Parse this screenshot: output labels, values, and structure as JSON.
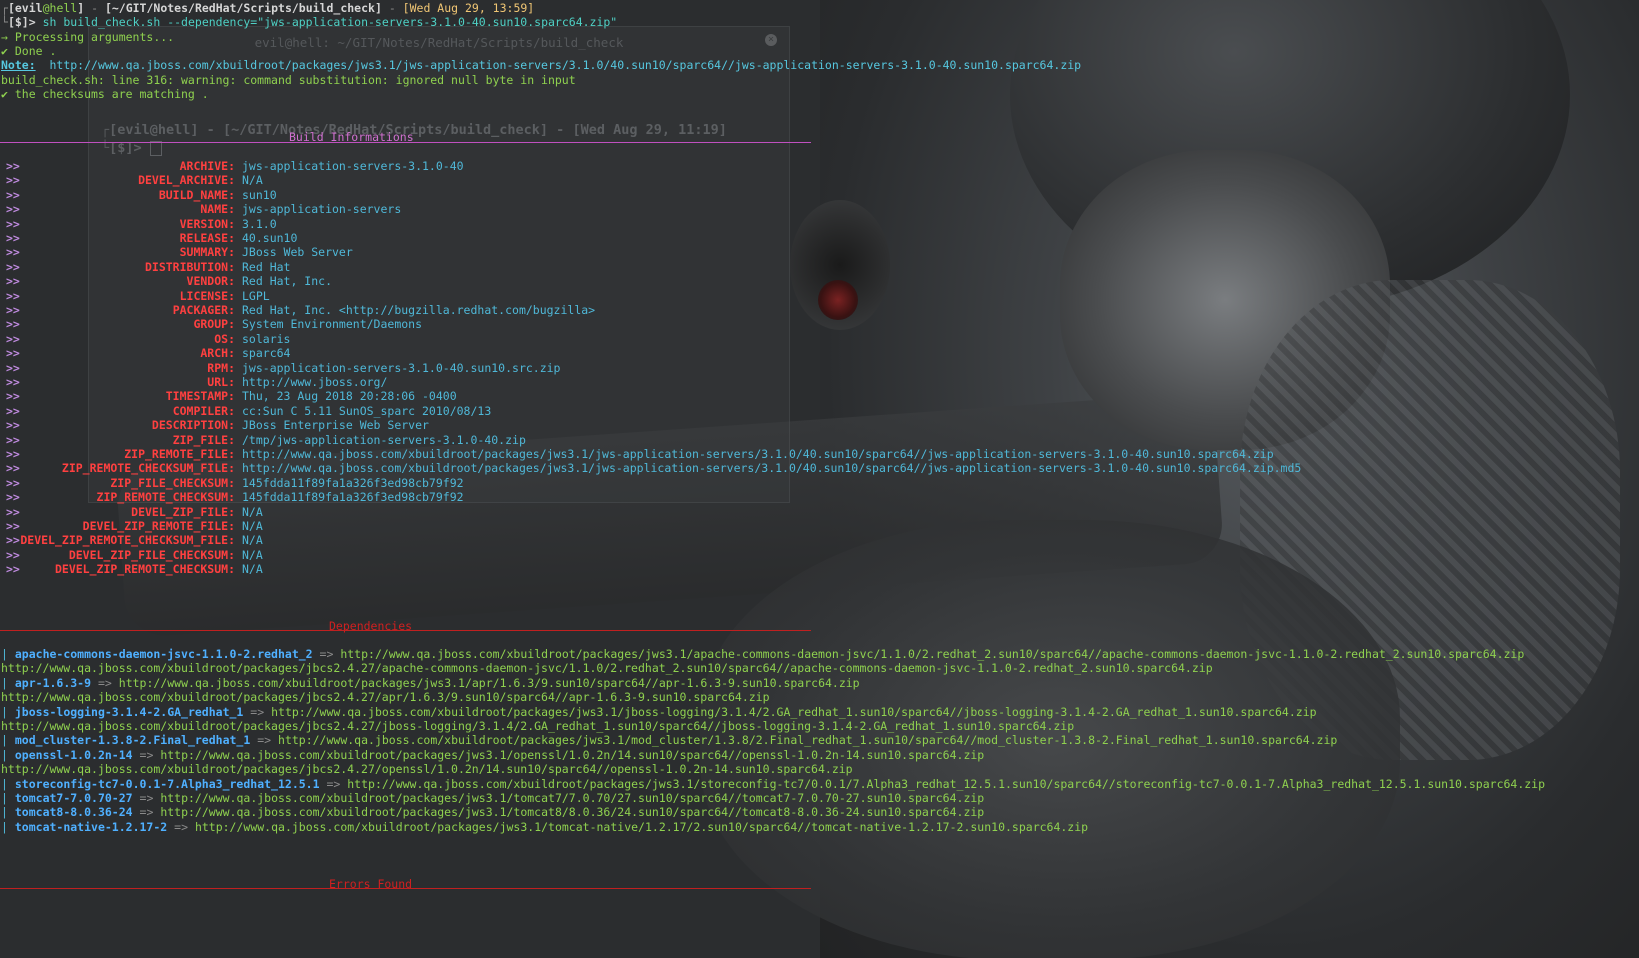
{
  "prompt": {
    "user": "evil",
    "at": "@",
    "host": "hell",
    "path": "[~/GIT/Notes/RedHat/Scripts/build_check]",
    "date": "[Wed Aug 29, 13:59]",
    "ps": "[$]>",
    "command": "sh build_check.sh --dependency=\"jws-application-servers-3.1.0-40.sun10.sparc64.zip\""
  },
  "log": {
    "processing": "→ Processing arguments...",
    "done": "✔ Done .",
    "note_label": "Note:",
    "note_url": "http://www.qa.jboss.com/xbuildroot/packages/jws3.1/jws-application-servers/3.1.0/40.sun10/sparc64//jws-application-servers-3.1.0-40.sun10.sparc64.zip",
    "warning": "build_check.sh: line 316: warning: command substitution: ignored null byte in input",
    "checksums": "✔ the checksums are matching ."
  },
  "ghost_window": {
    "title": "evil@hell: ~/GIT/Notes/RedHat/Scripts/build_check",
    "close": "×",
    "prompt_user": "[evil@hell]",
    "prompt_path": "[~/GIT/Notes/RedHat/Scripts/build_check]",
    "prompt_date": "[Wed Aug 29, 11:19]",
    "prompt_ps": "[$]>"
  },
  "build_info": {
    "title": "Build Informations",
    "arrows": ">>",
    "rows": [
      {
        "key": "ARCHIVE:",
        "value": "jws-application-servers-3.1.0-40"
      },
      {
        "key": "DEVEL_ARCHIVE:",
        "value": "N/A"
      },
      {
        "key": "BUILD_NAME:",
        "value": "sun10"
      },
      {
        "key": "NAME:",
        "value": "jws-application-servers"
      },
      {
        "key": "VERSION:",
        "value": "3.1.0"
      },
      {
        "key": "RELEASE:",
        "value": "40.sun10"
      },
      {
        "key": "SUMMARY:",
        "value": "JBoss Web Server"
      },
      {
        "key": "DISTRIBUTION:",
        "value": "Red Hat"
      },
      {
        "key": "VENDOR:",
        "value": "Red Hat, Inc."
      },
      {
        "key": "LICENSE:",
        "value": "LGPL"
      },
      {
        "key": "PACKAGER:",
        "value": "Red Hat, Inc. <http://bugzilla.redhat.com/bugzilla>"
      },
      {
        "key": "GROUP:",
        "value": "System Environment/Daemons"
      },
      {
        "key": "OS:",
        "value": "solaris"
      },
      {
        "key": "ARCH:",
        "value": "sparc64"
      },
      {
        "key": "RPM:",
        "value": "jws-application-servers-3.1.0-40.sun10.src.zip"
      },
      {
        "key": "URL:",
        "value": "http://www.jboss.org/"
      },
      {
        "key": "TIMESTAMP:",
        "value": "Thu, 23 Aug 2018 20:28:06 -0400"
      },
      {
        "key": "COMPILER:",
        "value": "cc:Sun C 5.11 SunOS_sparc 2010/08/13"
      },
      {
        "key": "DESCRIPTION:",
        "value": "JBoss Enterprise Web Server"
      },
      {
        "key": "ZIP_FILE:",
        "value": "/tmp/jws-application-servers-3.1.0-40.zip"
      },
      {
        "key": "ZIP_REMOTE_FILE:",
        "value": "http://www.qa.jboss.com/xbuildroot/packages/jws3.1/jws-application-servers/3.1.0/40.sun10/sparc64//jws-application-servers-3.1.0-40.sun10.sparc64.zip"
      },
      {
        "key": "ZIP_REMOTE_CHECKSUM_FILE:",
        "value": "http://www.qa.jboss.com/xbuildroot/packages/jws3.1/jws-application-servers/3.1.0/40.sun10/sparc64//jws-application-servers-3.1.0-40.sun10.sparc64.zip.md5"
      },
      {
        "key": "ZIP_FILE_CHECKSUM:",
        "value": "145fdda11f89fa1a326f3ed98cb79f92"
      },
      {
        "key": "ZIP_REMOTE_CHECKSUM:",
        "value": "145fdda11f89fa1a326f3ed98cb79f92"
      },
      {
        "key": "DEVEL_ZIP_FILE:",
        "value": "N/A"
      },
      {
        "key": "DEVEL_ZIP_REMOTE_FILE:",
        "value": "N/A"
      },
      {
        "key": "DEVEL_ZIP_REMOTE_CHECKSUM_FILE:",
        "value": "N/A"
      },
      {
        "key": "DEVEL_ZIP_FILE_CHECKSUM:",
        "value": "N/A"
      },
      {
        "key": "DEVEL_ZIP_REMOTE_CHECKSUM:",
        "value": "N/A"
      }
    ]
  },
  "dependencies": {
    "title": "Dependencies",
    "pipe": "|",
    "arrow": "=>",
    "items": [
      {
        "name": "apache-commons-daemon-jsvc-1.1.0-2.redhat_2",
        "url": "http://www.qa.jboss.com/xbuildroot/packages/jws3.1/apache-commons-daemon-jsvc/1.1.0/2.redhat_2.sun10/sparc64//apache-commons-daemon-jsvc-1.1.0-2.redhat_2.sun10.sparc64.zip",
        "alt": "http://www.qa.jboss.com/xbuildroot/packages/jbcs2.4.27/apache-commons-daemon-jsvc/1.1.0/2.redhat_2.sun10/sparc64//apache-commons-daemon-jsvc-1.1.0-2.redhat_2.sun10.sparc64.zip"
      },
      {
        "name": "apr-1.6.3-9",
        "url": "http://www.qa.jboss.com/xbuildroot/packages/jws3.1/apr/1.6.3/9.sun10/sparc64//apr-1.6.3-9.sun10.sparc64.zip",
        "alt": "http://www.qa.jboss.com/xbuildroot/packages/jbcs2.4.27/apr/1.6.3/9.sun10/sparc64//apr-1.6.3-9.sun10.sparc64.zip"
      },
      {
        "name": "jboss-logging-3.1.4-2.GA_redhat_1",
        "url": "http://www.qa.jboss.com/xbuildroot/packages/jws3.1/jboss-logging/3.1.4/2.GA_redhat_1.sun10/sparc64//jboss-logging-3.1.4-2.GA_redhat_1.sun10.sparc64.zip",
        "alt": "http://www.qa.jboss.com/xbuildroot/packages/jbcs2.4.27/jboss-logging/3.1.4/2.GA_redhat_1.sun10/sparc64//jboss-logging-3.1.4-2.GA_redhat_1.sun10.sparc64.zip"
      },
      {
        "name": "mod_cluster-1.3.8-2.Final_redhat_1",
        "url": "http://www.qa.jboss.com/xbuildroot/packages/jws3.1/mod_cluster/1.3.8/2.Final_redhat_1.sun10/sparc64//mod_cluster-1.3.8-2.Final_redhat_1.sun10.sparc64.zip",
        "alt": ""
      },
      {
        "name": "openssl-1.0.2n-14",
        "url": "http://www.qa.jboss.com/xbuildroot/packages/jws3.1/openssl/1.0.2n/14.sun10/sparc64//openssl-1.0.2n-14.sun10.sparc64.zip",
        "alt": "http://www.qa.jboss.com/xbuildroot/packages/jbcs2.4.27/openssl/1.0.2n/14.sun10/sparc64//openssl-1.0.2n-14.sun10.sparc64.zip"
      },
      {
        "name": "storeconfig-tc7-0.0.1-7.Alpha3_redhat_12.5.1",
        "url": "http://www.qa.jboss.com/xbuildroot/packages/jws3.1/storeconfig-tc7/0.0.1/7.Alpha3_redhat_12.5.1.sun10/sparc64//storeconfig-tc7-0.0.1-7.Alpha3_redhat_12.5.1.sun10.sparc64.zip",
        "alt": ""
      },
      {
        "name": "tomcat7-7.0.70-27",
        "url": "http://www.qa.jboss.com/xbuildroot/packages/jws3.1/tomcat7/7.0.70/27.sun10/sparc64//tomcat7-7.0.70-27.sun10.sparc64.zip",
        "alt": ""
      },
      {
        "name": "tomcat8-8.0.36-24",
        "url": "http://www.qa.jboss.com/xbuildroot/packages/jws3.1/tomcat8/8.0.36/24.sun10/sparc64//tomcat8-8.0.36-24.sun10.sparc64.zip",
        "alt": ""
      },
      {
        "name": "tomcat-native-1.2.17-2",
        "url": "http://www.qa.jboss.com/xbuildroot/packages/jws3.1/tomcat-native/1.2.17/2.sun10/sparc64//tomcat-native-1.2.17-2.sun10.sparc64.zip",
        "alt": ""
      }
    ]
  },
  "errors": {
    "title": "Errors Found"
  },
  "colors": {
    "background": "#2b2d2f",
    "magenta_rule": "#c050c0",
    "red_rule": "#c02020",
    "key_red": "#ff4040",
    "value_cyan": "#4fb8d8",
    "url_green": "#8fd14f",
    "dep_name_blue": "#4fb0ff"
  }
}
